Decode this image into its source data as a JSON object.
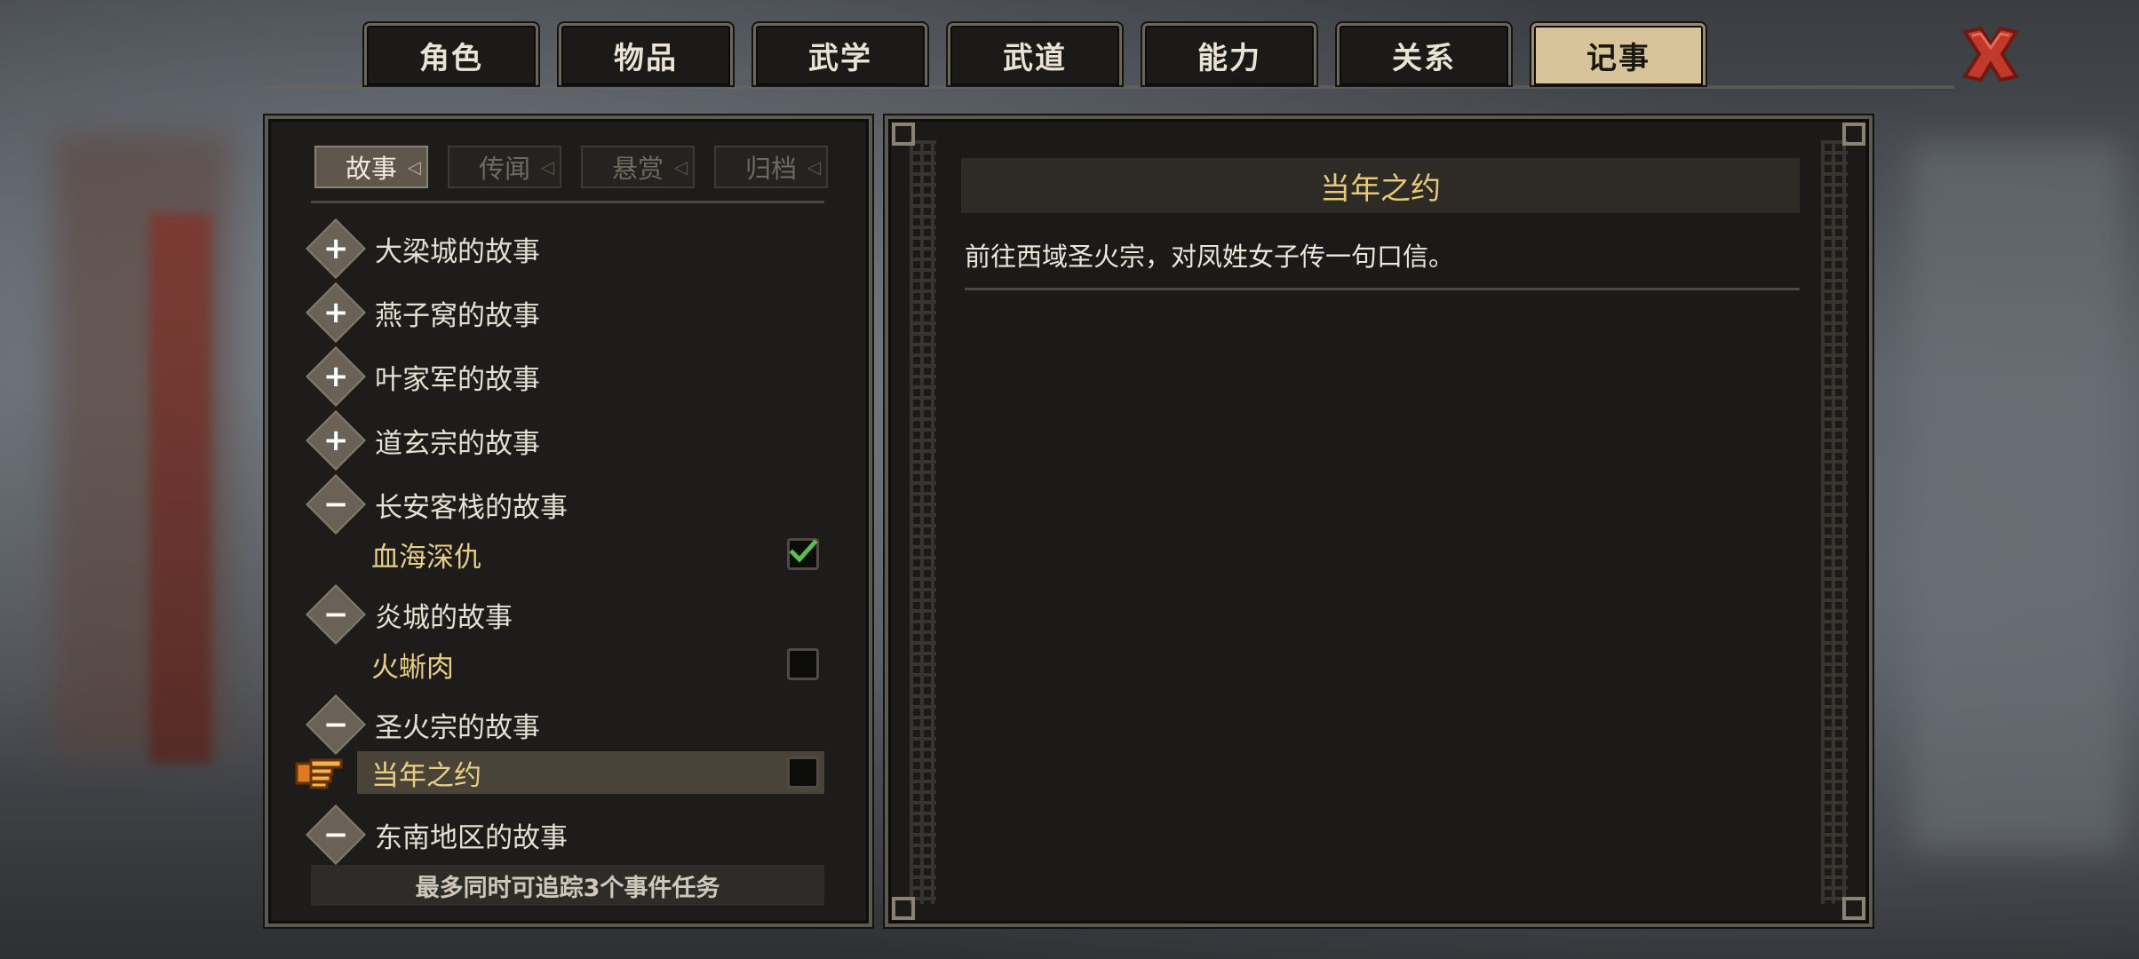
{
  "tabs": [
    "角色",
    "物品",
    "武学",
    "武道",
    "能力",
    "关系",
    "记事"
  ],
  "active_tab": "记事",
  "subtabs": [
    "故事",
    "传闻",
    "悬赏",
    "归档"
  ],
  "active_subtab": "故事",
  "story_groups": [
    {
      "label": "大梁城的故事",
      "expanded": false,
      "symbol": "+"
    },
    {
      "label": "燕子窝的故事",
      "expanded": false,
      "symbol": "+"
    },
    {
      "label": "叶家军的故事",
      "expanded": false,
      "symbol": "+"
    },
    {
      "label": "道玄宗的故事",
      "expanded": false,
      "symbol": "+"
    },
    {
      "label": "长安客栈的故事",
      "expanded": true,
      "symbol": "−",
      "quests": [
        {
          "label": "血海深仇",
          "tracked": true
        }
      ]
    },
    {
      "label": "炎城的故事",
      "expanded": true,
      "symbol": "−",
      "quests": [
        {
          "label": "火蜥肉",
          "tracked": false
        }
      ]
    },
    {
      "label": "圣火宗的故事",
      "expanded": true,
      "symbol": "−",
      "quests": [
        {
          "label": "当年之约",
          "tracked": false,
          "selected": true
        }
      ]
    },
    {
      "label": "东南地区的故事",
      "expanded": true,
      "symbol": "−"
    }
  ],
  "footer_note": "最多同时可追踪3个事件任务",
  "detail": {
    "title": "当年之约",
    "description": "前往西域圣火宗，对凤姓女子传一句口信。"
  },
  "colors": {
    "accent": "#e8cf86",
    "active_tab": "#d8c49a",
    "check": "#5bbf4e",
    "close": "#c0392b"
  }
}
